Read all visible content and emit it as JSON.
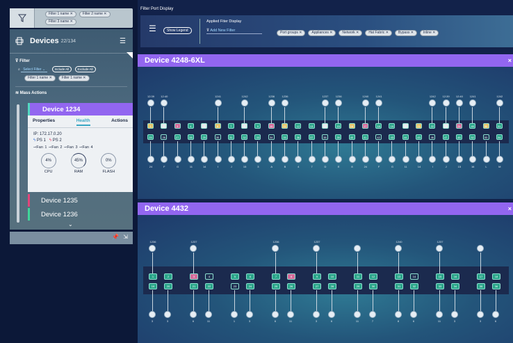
{
  "left": {
    "top_filters": [
      "Filter 1 name",
      "Filter 2 name",
      "Filter 3 name"
    ],
    "devices": {
      "title": "Devices",
      "count": "22/134"
    },
    "filter": {
      "label": "Filter",
      "select_placeholder": "Select Filter",
      "include_all": "Include All",
      "exclude_all": "Exclude All",
      "chips": [
        "Filter 1 name",
        "Filter 1 name"
      ]
    },
    "mass_actions": "Mass Actions",
    "card": {
      "name": "Device 1234",
      "tabs": [
        "Properties",
        "Health",
        "Actions"
      ],
      "ip": "IP: 172.17.0.20",
      "ps": [
        "PS 1",
        "PS 2"
      ],
      "fans": [
        "Fan 1",
        "Fan 2",
        "Fan 3",
        "Fan 4"
      ],
      "gauges": [
        {
          "value": "4%",
          "label": "CPU"
        },
        {
          "value": "45%",
          "label": "RAM"
        },
        {
          "value": "0%",
          "label": "FLASH"
        }
      ]
    },
    "other_devices": [
      {
        "name": "Device 1235",
        "color": "#e0457a"
      },
      {
        "name": "Device 1236",
        "color": "#3fd69a"
      }
    ]
  },
  "right": {
    "title": "Filter Port Display",
    "applied": {
      "label": "Applied Fiter Display",
      "show_legend": "Show Legend",
      "add_filter": "Add New Filter",
      "chips": [
        "Port groups",
        "Appliances",
        "Network",
        "Hat Fabric",
        "Bypass",
        "Inline"
      ]
    },
    "device1": {
      "name": "Device 4248-6XL",
      "top_row_codes": [
        "12:39",
        "12:40",
        "1241",
        "1242",
        "1236",
        "1236",
        "1237",
        "1236",
        "1240",
        "1241",
        "1242"
      ],
      "top_ports": [
        "1",
        "2",
        "3",
        "4",
        "5",
        "6",
        "7",
        "8",
        "9",
        "10",
        "11",
        "12",
        "13",
        "14",
        "15",
        "16",
        "17",
        "18",
        "19",
        "20",
        "21",
        "22",
        "23",
        "24",
        "49",
        "50",
        "51"
      ],
      "bottom_ports": [
        "25",
        "26",
        "27",
        "28",
        "29",
        "30",
        "31",
        "32",
        "33",
        "34",
        "35",
        "36",
        "37",
        "38",
        "39",
        "40",
        "41",
        "42",
        "43",
        "44",
        "45",
        "46",
        "47",
        "48",
        "52",
        "53",
        "54"
      ],
      "bottom_labels": [
        "24",
        "F",
        "G",
        "11",
        "14",
        "I",
        "J",
        "15",
        "3",
        "A",
        "B",
        "4",
        "7",
        "D",
        "E",
        "8",
        "24",
        "F",
        "G",
        "11",
        "14",
        "I",
        "J",
        "15",
        "16",
        "L",
        "M"
      ]
    },
    "device2": {
      "name": "Device 4432",
      "top_codes": [
        "1236",
        "1237",
        "1236",
        "1237",
        "",
        "1240",
        "1237",
        "",
        "1240",
        "1237",
        "",
        "1240"
      ],
      "top_ports": [
        "1",
        "2",
        "3",
        "4",
        "5",
        "6",
        "7",
        "8",
        "9",
        "10",
        "11",
        "12",
        "13",
        "14",
        "15",
        "16",
        "17",
        "18"
      ],
      "bottom_ports": [
        "19",
        "20",
        "21",
        "22",
        "23",
        "24",
        "25",
        "26",
        "27",
        "28",
        "29",
        "30",
        "31",
        "32",
        "33",
        "34",
        "35",
        "36"
      ],
      "bottom_labels": [
        "3",
        "3",
        "6",
        "11",
        "1",
        "3",
        "6",
        "11",
        "3",
        "6",
        "11",
        "7",
        "8",
        "6",
        "11"
      ]
    }
  }
}
